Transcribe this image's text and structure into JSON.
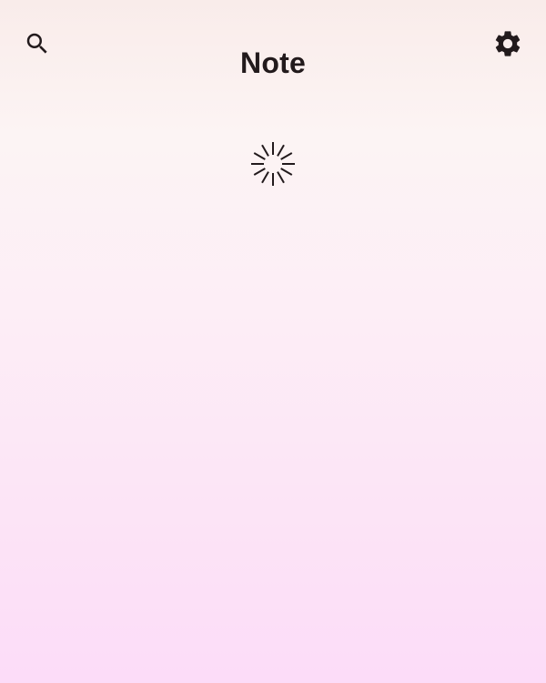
{
  "app": {
    "title": "Note"
  },
  "toolbar": {
    "search_icon": "search-icon",
    "settings_icon": "gear-icon"
  },
  "content": {
    "state": "loading",
    "loader_icon": "loading-spinner-icon"
  },
  "colors": {
    "foreground": "#221a1c",
    "background_top": "#f9ecea",
    "background_bottom": "#fcdcf8"
  }
}
